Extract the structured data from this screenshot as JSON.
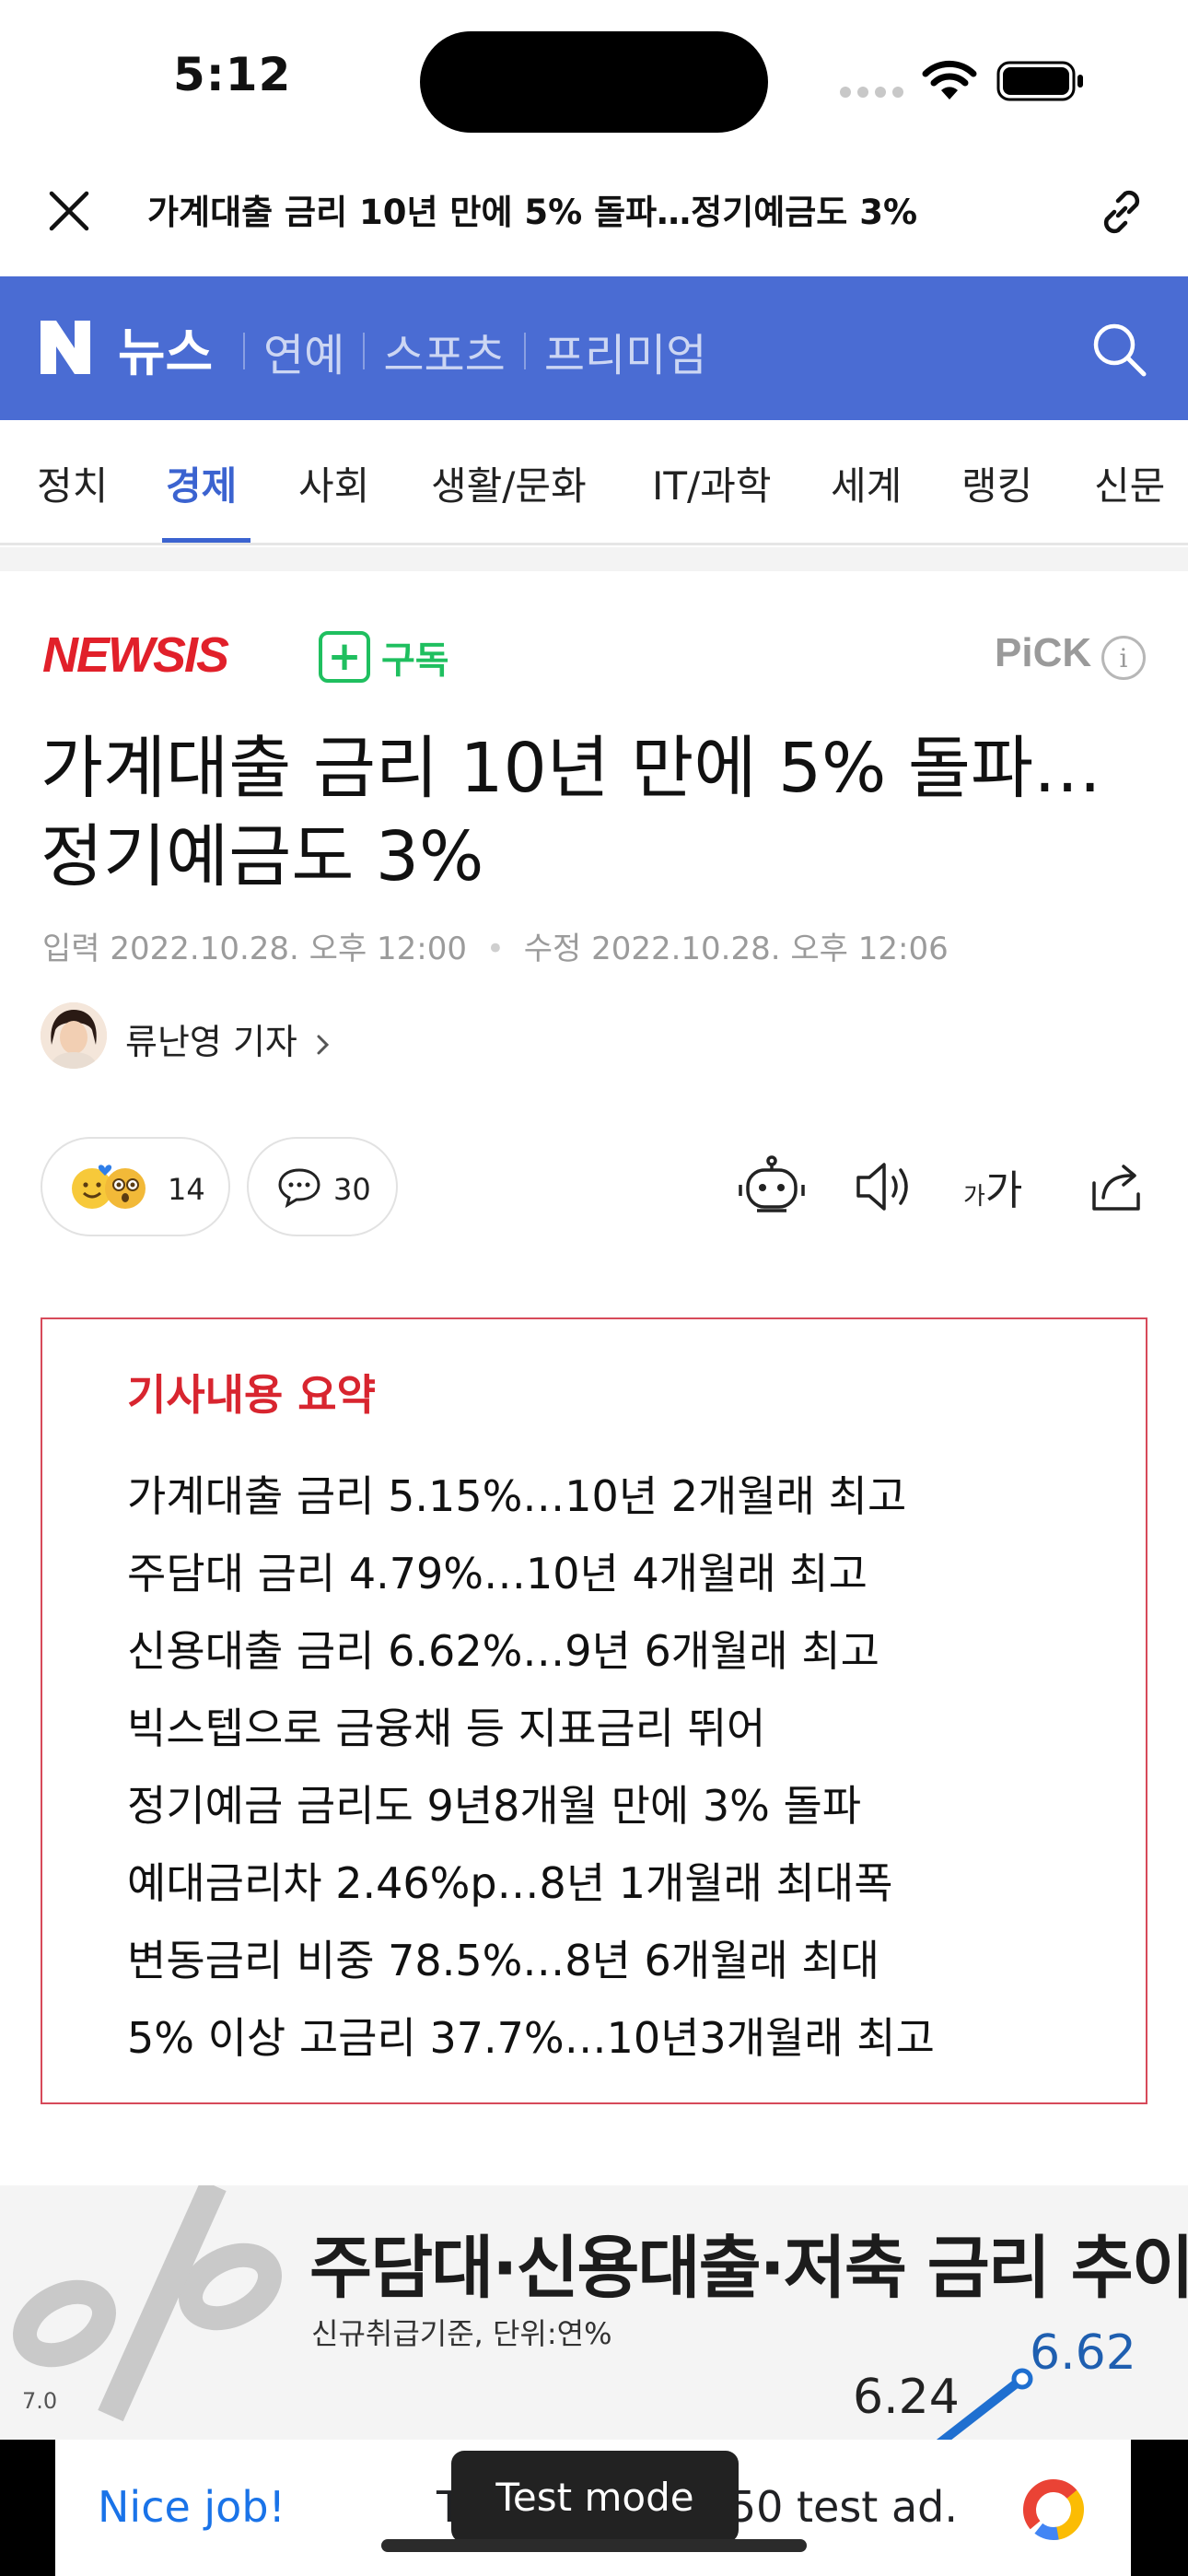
{
  "status_bar": {
    "time": "5:12"
  },
  "title_bar": {
    "title": "가계대출 금리 10년 만에 5% 돌파…정기예금도 3%"
  },
  "header": {
    "brand": "뉴스",
    "nav": [
      "연예",
      "스포츠",
      "프리미엄"
    ]
  },
  "categories": {
    "items": [
      "정치",
      "경제",
      "사회",
      "생활/문화",
      "IT/과학",
      "세계",
      "랭킹",
      "신문"
    ],
    "active": "경제"
  },
  "publisher": {
    "name": "NEWSIS",
    "subscribe_label": "구독",
    "pick_label": "PiCK",
    "info_glyph": "i"
  },
  "article": {
    "headline_line1": "가계대출 금리 10년 만에 5% 돌파…",
    "headline_line2": "정기예금도 3%",
    "input_label": "입력",
    "input_date": "2022.10.28. 오후 12:00",
    "modified_label": "수정",
    "modified_date": "2022.10.28. 오후 12:06",
    "reporter": "류난영 기자",
    "reaction_count": "14",
    "comment_count": "30",
    "font_small": "가",
    "font_big": "가"
  },
  "summary": {
    "title": "기사내용 요약",
    "lines": [
      "가계대출 금리 5.15%…10년 2개월래 최고",
      "주담대 금리 4.79%…10년 4개월래 최고",
      "신용대출 금리 6.62%…9년 6개월래 최고",
      "빅스텝으로 금융채 등 지표금리 뛰어",
      "정기예금 금리도 9년8개월 만에 3% 돌파",
      "예대금리차 2.46%p…8년 1개월래 최대폭",
      "변동금리 비중 78.5%…8년 6개월래 최대",
      "5% 이상 고금리 37.7%…10년3개월래 최고"
    ]
  },
  "infographic": {
    "title": "주담대·신용대출·저축 금리 추이",
    "subtitle": "신규취급기준, 단위:연%",
    "axis_label": "7.0",
    "value_a": "6.24",
    "value_b": "6.62"
  },
  "ad": {
    "nice": "Nice job!",
    "text": "This is a 320x50 test ad.",
    "test_mode": "Test mode"
  },
  "colors": {
    "header_blue": "#4a6cd3",
    "active_tab": "#3b63d0",
    "publisher_red": "#e1202a",
    "subscribe_green": "#1fbf5f",
    "summary_red": "#d8252f"
  }
}
